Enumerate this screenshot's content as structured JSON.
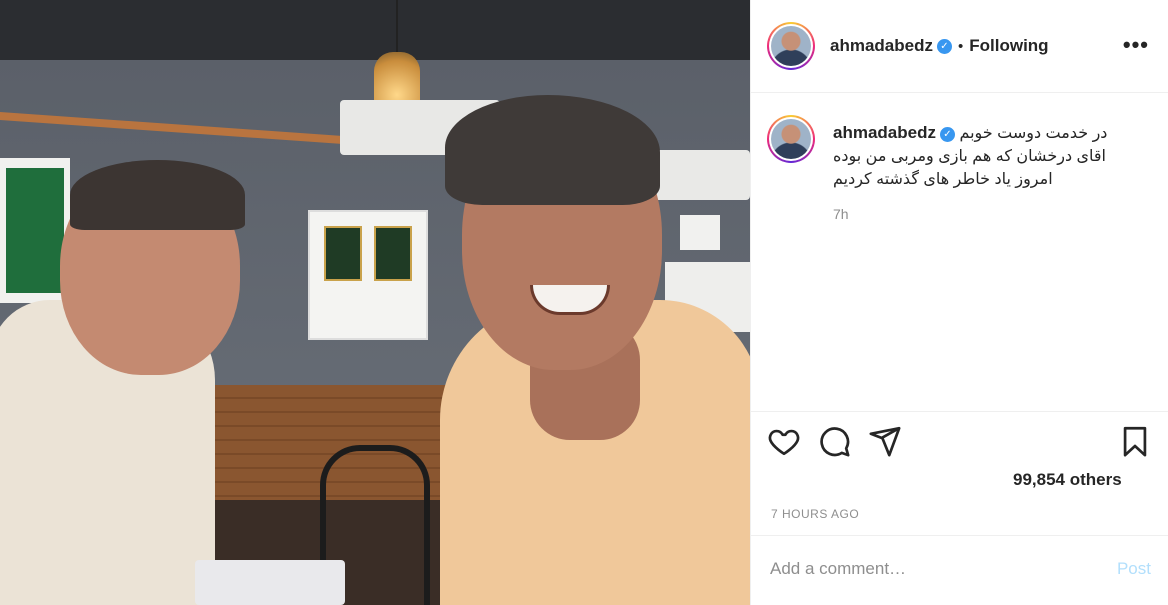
{
  "post": {
    "username": "ahmadabedz",
    "verified_symbol": "✓",
    "separator": "•",
    "follow_status": "Following",
    "more_symbol": "•••"
  },
  "caption": {
    "username": "ahmadabedz",
    "lines": [
      "در خدمت دوست خوبم",
      "اقای درخشان که هم بازی ومربی من بوده",
      "امروز یاد خاطر های گذشته کردیم"
    ],
    "time": "7h"
  },
  "actions": {
    "icons": [
      "heart-icon",
      "comment-icon",
      "share-icon",
      "bookmark-icon"
    ],
    "likes_text": "99,854 others",
    "timestamp": "7 HOURS AGO"
  },
  "comment_box": {
    "placeholder": "Add a comment…",
    "post_label": "Post"
  },
  "colors": {
    "verified": "#3897f0",
    "post_disabled": "#b2dffc",
    "muted": "#8e8e8e"
  }
}
